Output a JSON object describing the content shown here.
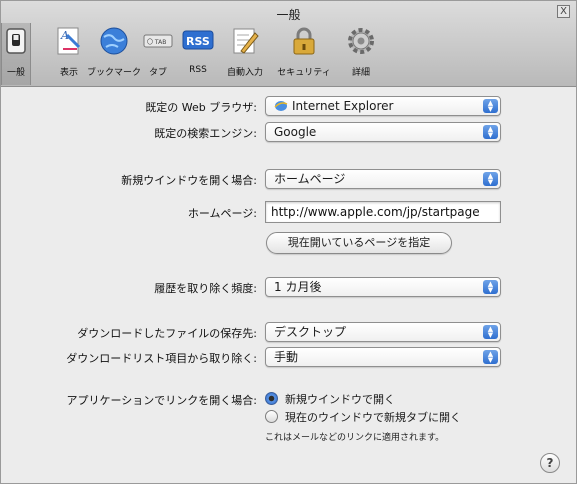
{
  "window": {
    "title": "一般",
    "close_glyph": "X"
  },
  "toolbar": {
    "items": [
      {
        "label": "一般",
        "icon": "general-switch-icon",
        "selected": true
      },
      {
        "label": "表示",
        "icon": "appearance-icon",
        "selected": false
      },
      {
        "label": "ブックマーク",
        "icon": "bookmarks-globe-icon",
        "selected": false
      },
      {
        "label": "タブ",
        "icon": "tabs-icon",
        "selected": false
      },
      {
        "label": "RSS",
        "icon": "rss-icon",
        "selected": false
      },
      {
        "label": "自動入力",
        "icon": "autofill-pencil-icon",
        "selected": false
      },
      {
        "label": "セキュリティ",
        "icon": "security-lock-icon",
        "selected": false
      },
      {
        "label": "詳細",
        "icon": "advanced-gear-icon",
        "selected": false
      }
    ],
    "tabs_icon_text": "〇 TAB",
    "rss_icon_text": "RSS"
  },
  "settings": {
    "default_browser": {
      "label": "既定の Web ブラウザ:",
      "value": "Internet Explorer"
    },
    "default_search": {
      "label": "既定の検索エンジン:",
      "value": "Google"
    },
    "new_window": {
      "label": "新規ウインドウを開く場合:",
      "value": "ホームページ"
    },
    "homepage": {
      "label": "ホームページ:",
      "value": "http://www.apple.com/jp/startpage"
    },
    "set_current_button": "現在開いているページを指定",
    "history": {
      "label": "履歴を取り除く頻度:",
      "value": "1 カ月後"
    },
    "download_location": {
      "label": "ダウンロードしたファイルの保存先:",
      "value": "デスクトップ"
    },
    "download_list": {
      "label": "ダウンロードリスト項目から取り除く:",
      "value": "手動"
    },
    "open_links": {
      "label": "アプリケーションでリンクを開く場合:",
      "options": [
        "新規ウインドウで開く",
        "現在のウインドウで新規タブに開く"
      ],
      "selected": 0,
      "note": "これはメールなどのリンクに適用されます。"
    }
  },
  "help_glyph": "?"
}
